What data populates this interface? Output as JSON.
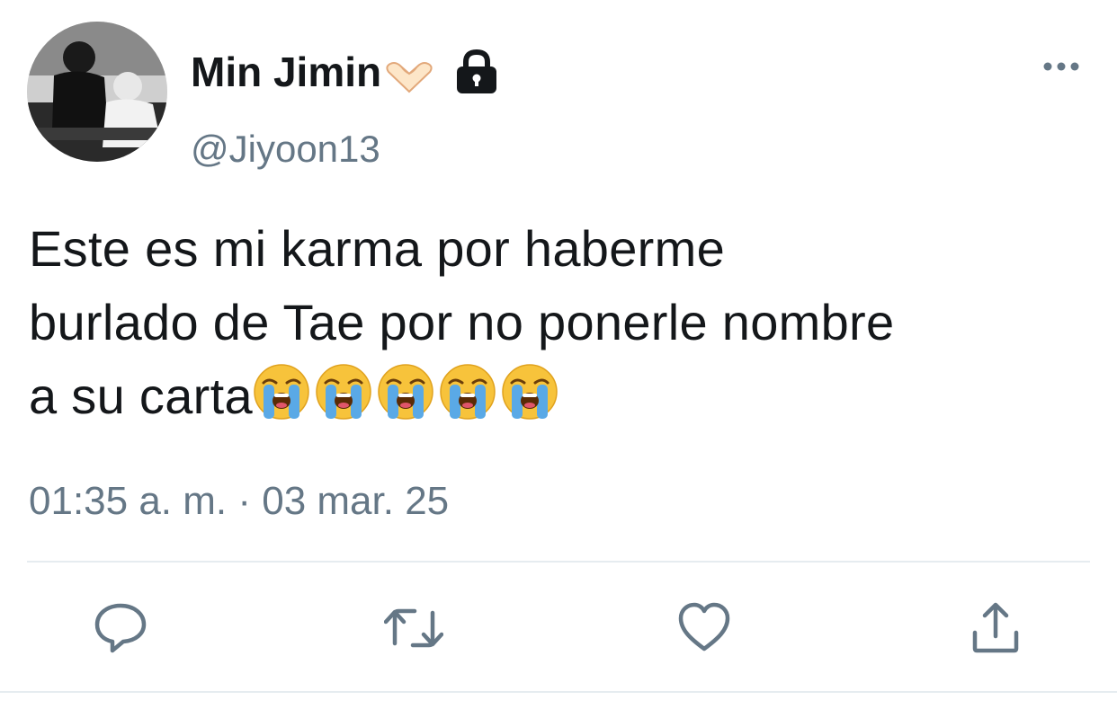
{
  "tweet": {
    "display_name": "Min Jimin",
    "name_emoji": "heart-hands-emoji",
    "protected_icon": "lock-icon",
    "handle": "@Jiyoon13",
    "text_lines": [
      "Este es mi karma por haberme",
      "burlado de Tae por no ponerle nombre",
      "a su carta"
    ],
    "trailing_emoji": "loudly-crying-face-emoji",
    "trailing_emoji_count": 5,
    "timestamp": "01:35 a. m. · 03 mar. 25"
  },
  "actions": [
    {
      "icon": "reply-icon"
    },
    {
      "icon": "retweet-icon"
    },
    {
      "icon": "like-icon"
    },
    {
      "icon": "share-icon"
    }
  ],
  "colors": {
    "text": "#14171a",
    "secondary": "#657786",
    "divider": "#e6ecf0",
    "emoji_yellow": "#f7c33b",
    "emoji_tear": "#5aa9e6"
  }
}
